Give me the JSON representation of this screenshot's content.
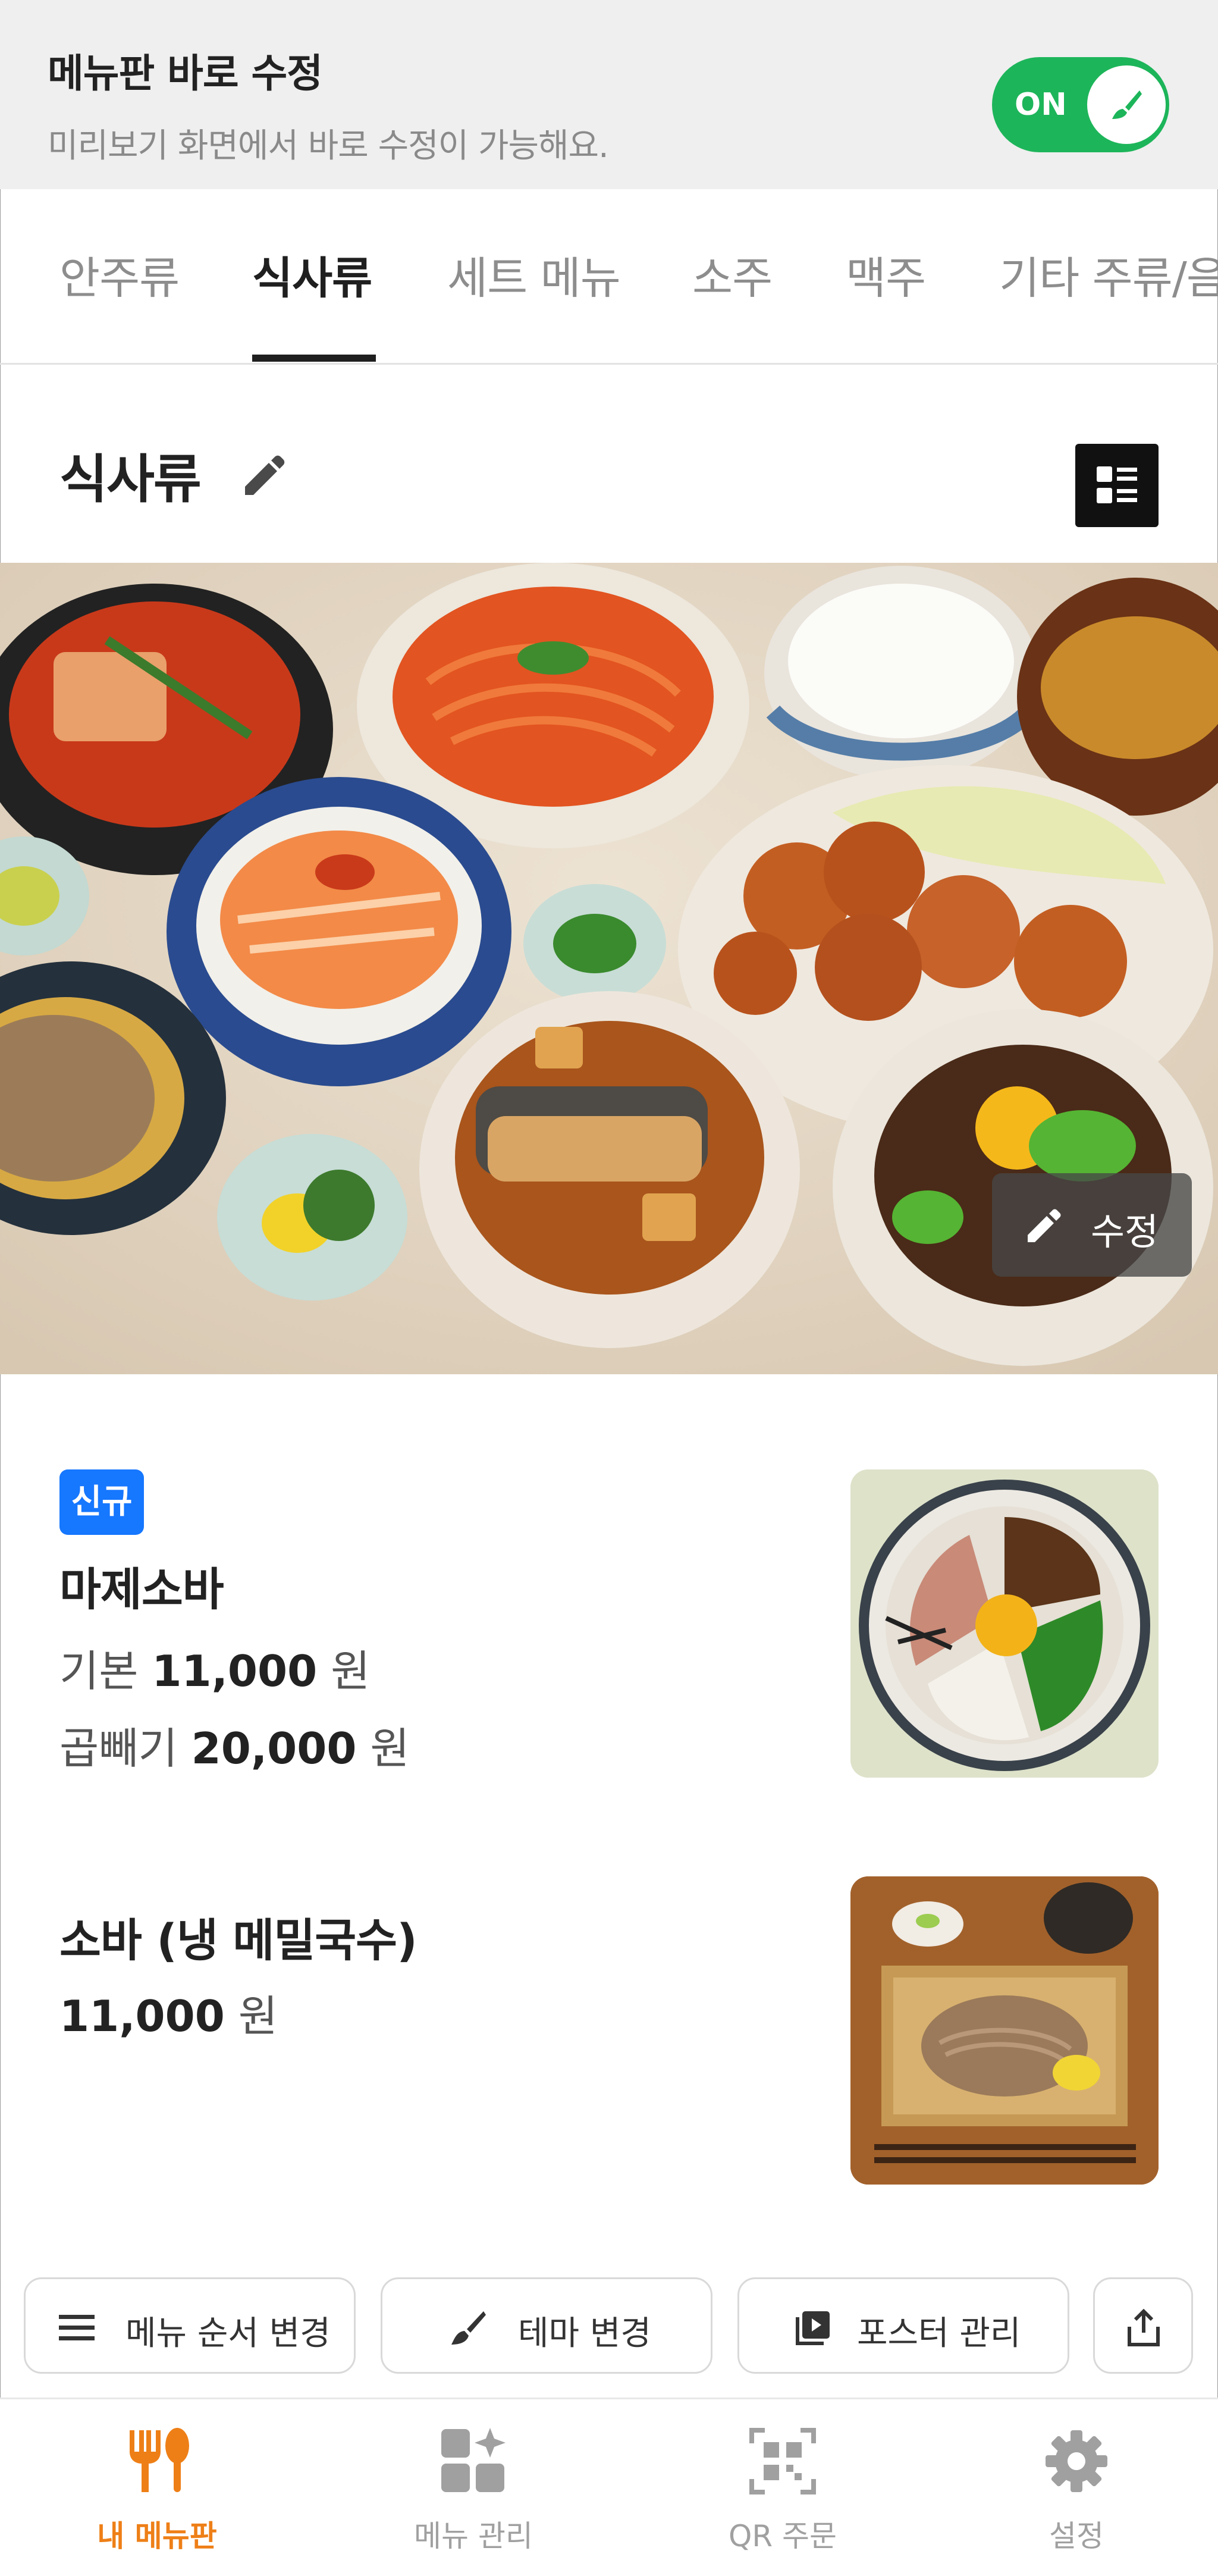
{
  "banner": {
    "title": "메뉴판 바로 수정",
    "subtitle": "미리보기 화면에서 바로 수정이 가능해요.",
    "toggle_label": "ON",
    "toggle_on": true
  },
  "tabs": [
    {
      "label": "안주류",
      "active": false
    },
    {
      "label": "식사류",
      "active": true
    },
    {
      "label": "세트 메뉴",
      "active": false
    },
    {
      "label": "소주",
      "active": false
    },
    {
      "label": "맥주",
      "active": false
    },
    {
      "label": "기타 주류/음",
      "active": false
    }
  ],
  "section": {
    "title": "식사류"
  },
  "hero": {
    "edit_label": "수정"
  },
  "items": [
    {
      "badge": "신규",
      "name": "마제소바",
      "prices": [
        {
          "option": "기본",
          "amount": "11,000",
          "unit": "원"
        },
        {
          "option": "곱빼기",
          "amount": "20,000",
          "unit": "원"
        }
      ]
    },
    {
      "name": "소바 (냉 메밀국수)",
      "prices": [
        {
          "option": "",
          "amount": "11,000",
          "unit": "원"
        }
      ]
    }
  ],
  "actions": {
    "reorder": "메뉴 순서 변경",
    "theme": "테마 변경",
    "poster": "포스터 관리",
    "share_icon": "share-icon"
  },
  "bottom_nav": [
    {
      "label": "내 메뉴판",
      "icon": "fork-spoon-icon",
      "active": true
    },
    {
      "label": "메뉴 관리",
      "icon": "grid-sparkle-icon",
      "active": false
    },
    {
      "label": "QR 주문",
      "icon": "qr-icon",
      "active": false
    },
    {
      "label": "설정",
      "icon": "gear-icon",
      "active": false
    }
  ],
  "colors": {
    "toggle_green": "#1db55a",
    "badge_blue": "#1677ff",
    "active_nav_orange": "#ee7f17"
  }
}
